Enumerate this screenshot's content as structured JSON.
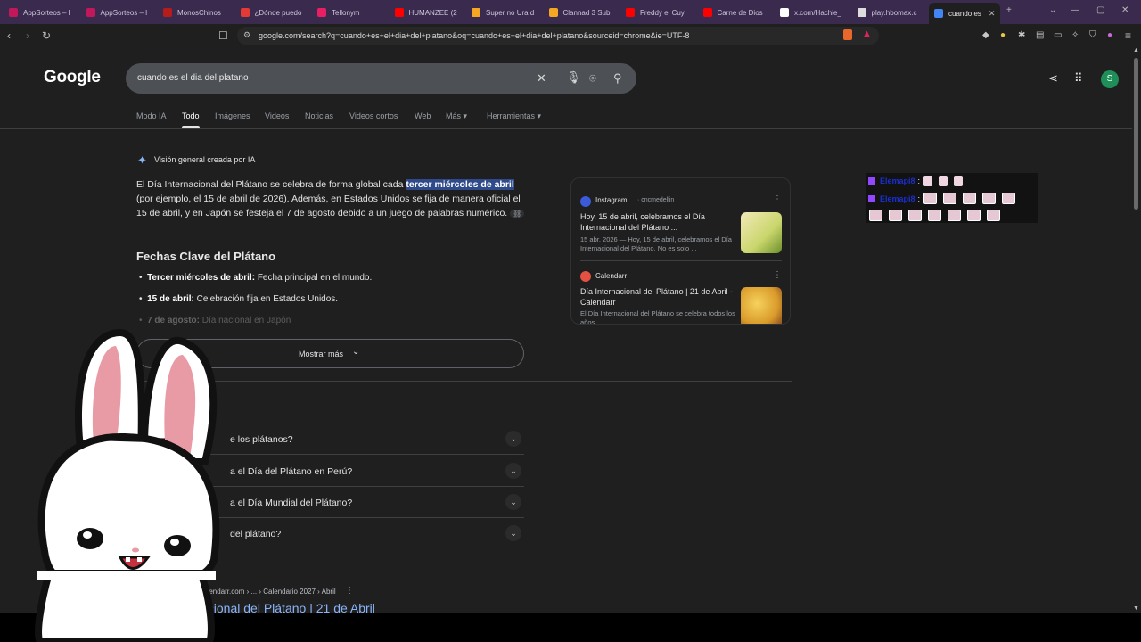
{
  "browser": {
    "tabs": [
      {
        "label": "AppSorteos – l",
        "color": "#c2185b"
      },
      {
        "label": "AppSorteos – l",
        "color": "#c2185b"
      },
      {
        "label": "MonosChinos",
        "color": "#b71c1c"
      },
      {
        "label": "¿Dónde puedo",
        "color": "#e53935"
      },
      {
        "label": "Tellonym",
        "color": "#e91e63"
      },
      {
        "label": "HUMANZEE (2",
        "color": "#ff0000"
      },
      {
        "label": "Super no Ura d",
        "color": "#f5a623"
      },
      {
        "label": "Clannad 3 Sub",
        "color": "#f5a623"
      },
      {
        "label": "Freddy el Cuy",
        "color": "#ff0000"
      },
      {
        "label": "Carne de Dios",
        "color": "#ff0000"
      },
      {
        "label": "x.com/Hachie_",
        "color": "#ffffff"
      },
      {
        "label": "play.hbomax.c",
        "color": "#dddddd"
      },
      {
        "label": "cuando es",
        "color": "#4285f4"
      }
    ],
    "new_tab": "+",
    "url": "google.com/search?q=cuando+es+el+dia+del+platano&oq=cuando+es+el+dia+del+platano&sourceid=chrome&ie=UTF-8"
  },
  "google": {
    "logo": "Google",
    "query": "cuando es el dia del platano",
    "avatar_letter": "S",
    "tabs": [
      "Modo IA",
      "Todo",
      "Imágenes",
      "Videos",
      "Noticias",
      "Videos cortos",
      "Web",
      "Más",
      "Herramientas"
    ],
    "tab_arrows": {
      "mas": "▾",
      "herramientas": "▾"
    }
  },
  "ai_overview": {
    "label": "Visión general creada por IA",
    "para_pre": "El Día Internacional del Plátano se celebra de forma global cada ",
    "para_highlight": "tercer miércoles de abril",
    "para_post": " (por ejemplo, el 15 de abril de 2026). Además, en Estados Unidos se fija de manera oficial el 15 de abril, y en Japón se festeja el 7 de agosto debido a un juego de palabras numérico.",
    "heading": "Fechas Clave del Plátano",
    "bullets": [
      {
        "bold": "Tercer miércoles de abril:",
        "text": " Fecha principal en el mundo."
      },
      {
        "bold": "15 de abril:",
        "text": " Celebración fija en Estados Unidos."
      },
      {
        "bold": "7 de agosto:",
        "text": " Día nacional en Japón"
      }
    ],
    "show_more": "Mostrar más"
  },
  "sources": [
    {
      "name": "Instagram",
      "handle": "cncmedellin",
      "title": "Hoy, 15 de abril, celebramos el Día Internacional del Plátano ...",
      "snippet": "15 abr. 2026 — Hoy, 15 de abril, celebramos el Día Internacional del Plátano. No es solo ..."
    },
    {
      "name": "Calendarr",
      "title": "Día Internacional del Plátano | 21 de Abril - Calendarr",
      "snippet": "El Día Internacional del Plátano se celebra todos los años..."
    }
  ],
  "questions": [
    "e los plátanos?",
    "a el Día del Plátano en Perú?",
    "a el Día Mundial del Plátano?",
    "del plátano?"
  ],
  "result": {
    "url": "www.calendarr.com › ... › Calendario 2027 › Abril",
    "title": "acional del Plátano | 21 de Abril"
  },
  "chat_overlay": {
    "lines": [
      {
        "user": "Elemapi8",
        "emotes": 3
      },
      {
        "user": "Elemapi8",
        "emotes": 12
      }
    ]
  }
}
